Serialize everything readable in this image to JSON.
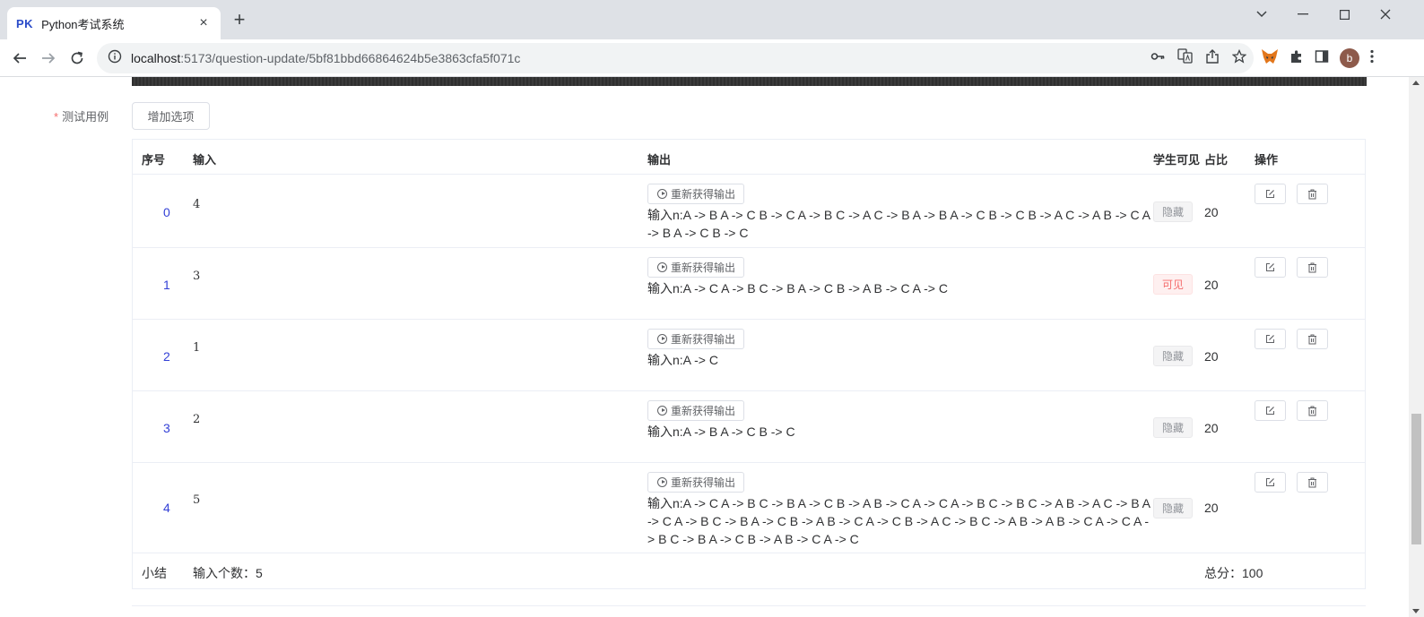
{
  "browser": {
    "tab": {
      "favicon_text": "PK",
      "title": "Python考试系统"
    },
    "url_host": "localhost",
    "url_rest": ":5173/question-update/5bf81bbd66864624b5e3863cfa5f071c",
    "avatar_letter": "b"
  },
  "form": {
    "label": "测试用例",
    "required_mark": "*",
    "add_button": "增加选项"
  },
  "table": {
    "headers": {
      "index": "序号",
      "input": "输入",
      "output": "输出",
      "visible": "学生可见",
      "ratio": "占比",
      "actions": "操作"
    },
    "regen_label": "重新获得输出",
    "rows": [
      {
        "index": "0",
        "input": "4",
        "output": "输入n:A -> B A -> C B -> C A -> B C -> A C -> B A -> B A -> C B -> C B -> A C -> A B -> C A -> B A -> C B -> C",
        "visibility": "隐藏",
        "visible": false,
        "ratio": "20"
      },
      {
        "index": "1",
        "input": "3",
        "output": "输入n:A -> C A -> B C -> B A -> C B -> A B -> C A -> C",
        "visibility": "可见",
        "visible": true,
        "ratio": "20"
      },
      {
        "index": "2",
        "input": "1",
        "output": "输入n:A -> C",
        "visibility": "隐藏",
        "visible": false,
        "ratio": "20"
      },
      {
        "index": "3",
        "input": "2",
        "output": "输入n:A -> B A -> C B -> C",
        "visibility": "隐藏",
        "visible": false,
        "ratio": "20"
      },
      {
        "index": "4",
        "input": "5",
        "output": "输入n:A -> C A -> B C -> B A -> C B -> A B -> C A -> C A -> B C -> B C -> A B -> A C -> B A -> C A -> B C -> B A -> C B -> A B -> C A -> C B -> A C -> B C -> A B -> A B -> C A -> C A -> B C -> B A -> C B -> A B -> C A -> C",
        "visibility": "隐藏",
        "visible": false,
        "ratio": "20"
      }
    ],
    "footer": {
      "label": "小结",
      "input_count": "输入个数：5",
      "total": "总分：100"
    }
  }
}
